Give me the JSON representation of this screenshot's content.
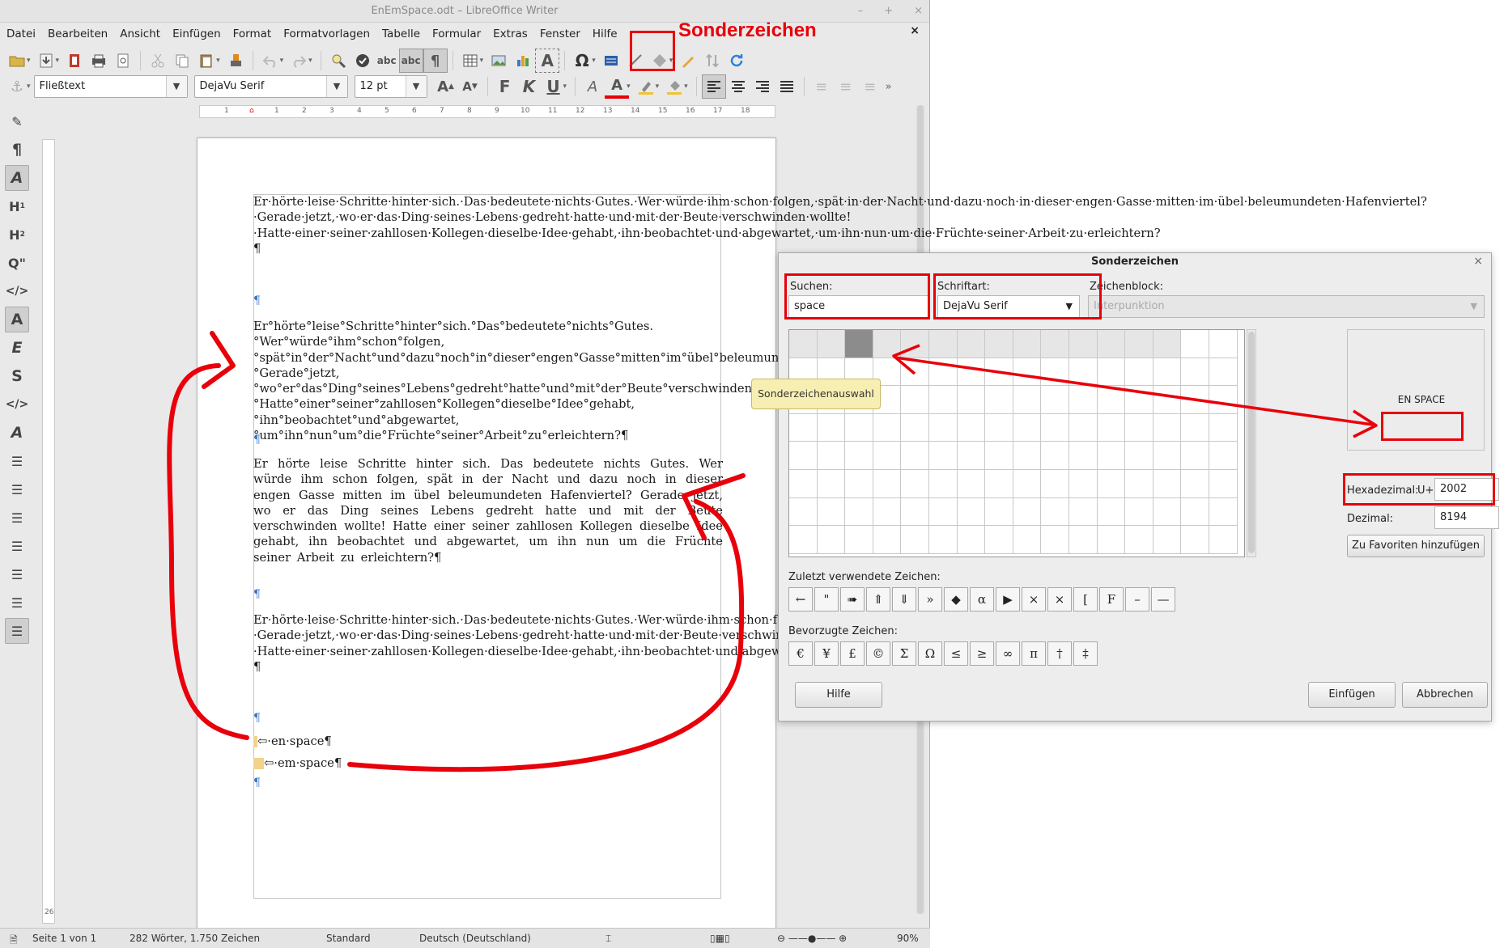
{
  "window": {
    "title": "EnEmSpace.odt – LibreOffice Writer",
    "controls": [
      "–",
      "+",
      "×"
    ]
  },
  "menubar": [
    "Datei",
    "Bearbeiten",
    "Ansicht",
    "Einfügen",
    "Format",
    "Formatvorlagen",
    "Tabelle",
    "Formular",
    "Extras",
    "Fenster",
    "Hilfe"
  ],
  "menu_close": "×",
  "annotation": {
    "callout": "Sonderzeichen",
    "color": "#e8000a"
  },
  "formatting": {
    "paragraph_style": "Fließtext",
    "font_name": "DejaVu Serif",
    "font_size": "12 pt"
  },
  "ruler": {
    "labels": [
      "1",
      "1",
      "2",
      "3",
      "4",
      "5",
      "6",
      "7",
      "8",
      "9",
      "10",
      "11",
      "12",
      "13",
      "14",
      "15",
      "16",
      "17",
      "18"
    ]
  },
  "vruler_label": "26",
  "document": {
    "paragraphs": [
      "Er·hörte·leise·Schritte·hinter·sich.·Das·bedeutete·nichts·Gutes.·Wer·würde·ihm·schon·folgen,·spät·in·der·Nacht·und·dazu·noch·in·dieser·engen·Gasse·mitten·im·übel·beleumundeten·Hafenviertel?·Gerade·jetzt,·wo·er·das·Ding·seines·Lebens·gedreht·hatte·und·mit·der·Beute·verschwinden·wollte!·Hatte·einer·seiner·zahllosen·Kollegen·dieselbe·Idee·gehabt,·ihn·beobachtet·und·abgewartet,·um·ihn·nun·um·die·Früchte·seiner·Arbeit·zu·erleichtern?¶",
      "Er°hörte°leise°Schritte°hinter°sich.°Das°bedeutete°nichts°Gutes.°Wer°würde°ihm°schon°folgen,°spät°in°der°Nacht°und°dazu°noch°in°dieser°engen°Gasse°mitten°im°übel°beleumundeten°Hafenviertel?°Gerade°jetzt,°wo°er°das°Ding°seines°Lebens°gedreht°hatte°und°mit°der°Beute°verschwinden°wollte!°Hatte°einer°seiner°zahllosen°Kollegen°dieselbe°Idee°gehabt,°ihn°beobachtet°und°abgewartet,°um°ihn°nun°um°die°Früchte°seiner°Arbeit°zu°erleichtern?¶",
      "Er hörte leise Schritte hinter sich. Das bedeutete nichts Gutes. Wer würde ihm schon folgen, spät in der Nacht und dazu noch in dieser engen Gasse mitten im übel beleumundeten Hafenviertel? Gerade jetzt, wo er das Ding seines Lebens gedreht hatte und mit der Beute verschwinden wollte! Hatte einer seiner zahllosen Kollegen dieselbe Idee gehabt, ihn beobachtet und abgewartet, um ihn nun um die Früchte seiner Arbeit zu erleichtern?¶",
      "Er·hörte·leise·Schritte·hinter·sich.·Das·bedeutete·nichts·Gutes.·Wer·würde·ihm·schon·folgen,·spät·in·der·Nacht·und·dazu·noch·in·dieser·engen·Gasse·mitten·im·übel·beleumundeten·Hafenviertel?·Gerade·jetzt,·wo·er·das·Ding·seines·Lebens·gedreht·hatte·und·mit·der·Beute·verschwinden·wollte!·Hatte·einer·seiner·zahllosen·Kollegen·dieselbe·Idee·gehabt,·ihn·beobachtet·und·abgewartet,·um·ihn·nun·um·die·Früchte·seiner·Arbeit·zu·erleichtern?¶"
    ],
    "pilcrow": "¶",
    "en_space_line": "⇦·en·space¶",
    "em_space_line": "⇦·em·space¶"
  },
  "statusbar": {
    "page": "Seite 1 von 1",
    "words": "282 Wörter, 1.750 Zeichen",
    "style": "Standard",
    "language": "Deutsch (Deutschland)",
    "zoom": "90%"
  },
  "dialog": {
    "title": "Sonderzeichen",
    "close": "×",
    "search_label": "Suchen:",
    "search_value": "space",
    "font_label": "Schriftart:",
    "font_value": "DejaVu Serif",
    "block_label": "Zeichenblock:",
    "block_value": "Interpunktion",
    "char_name": "EN SPACE",
    "hex_label": "Hexadezimal:",
    "hex_prefix": "U+",
    "hex_value": "2002",
    "dec_label": "Dezimal:",
    "dec_value": "8194",
    "add_favorite": "Zu Favoriten hinzufügen",
    "recent_label": "Zuletzt verwendete Zeichen:",
    "recent_chars": [
      "←",
      "\"",
      "➠",
      "⇑",
      "⇓",
      "»",
      "◆",
      "α",
      "▶",
      "×",
      "×",
      "[",
      "F",
      "–",
      "—"
    ],
    "favorite_label": "Bevorzugte Zeichen:",
    "favorite_chars": [
      "€",
      "¥",
      "£",
      "©",
      "Σ",
      "Ω",
      "≤",
      "≥",
      "∞",
      "π",
      "†",
      "‡"
    ],
    "help_button": "Hilfe",
    "insert_button": "Einfügen",
    "cancel_button": "Abbrechen",
    "tooltip": "Sonderzeichenauswahl"
  }
}
